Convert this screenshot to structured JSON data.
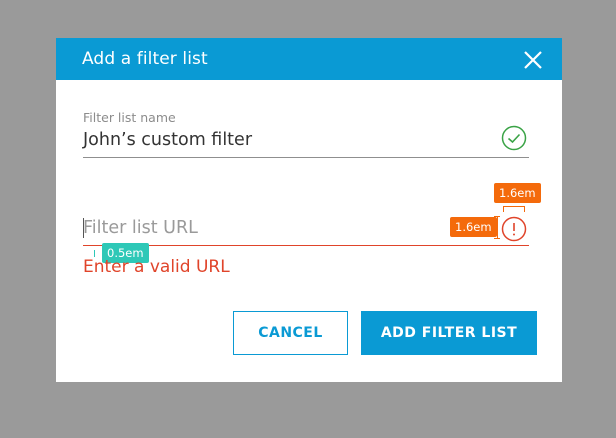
{
  "dialog": {
    "title": "Add a filter list",
    "close_icon": "close-icon"
  },
  "fields": {
    "name": {
      "label": "Filter list name",
      "value": "John’s custom filter",
      "status_icon": "check-circle-icon"
    },
    "url": {
      "placeholder": "Filter list URL",
      "value": "",
      "error": "Enter a valid URL",
      "status_icon": "alert-circle-icon"
    }
  },
  "annotations": {
    "top_spacing": "1.6em",
    "side_spacing": "1.6em",
    "gap_spacing": "0.5em"
  },
  "buttons": {
    "cancel": "CANCEL",
    "add": "ADD FILTER LIST"
  },
  "colors": {
    "primary": "#0a9ad4",
    "error": "#e0442a",
    "success": "#3aa346",
    "annotation_orange": "#f46a0b",
    "annotation_teal": "#2ec8b7",
    "overlay": "#9a9a9a"
  }
}
